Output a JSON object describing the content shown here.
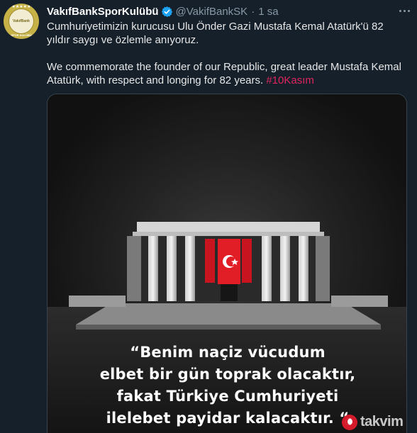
{
  "tweet": {
    "display_name": "VakıfBankSporKulübü",
    "handle": "@VakifBankSK",
    "separator": "·",
    "time": "1 sa",
    "text_tr": "Cumhuriyetimizin kurucusu Ulu Önder Gazi Mustafa Kemal Atatürk'ü 82 yıldır saygı ve özlemle anıyoruz.",
    "text_en": "We commemorate the founder of our Republic, great leader Mustafa Kemal Atatürk, with respect and longing for 82 years.",
    "hashtag": "#10Kasım"
  },
  "avatar": {
    "stars": "★★★★★",
    "brand": "VakıfBank",
    "bottom": "SPOR KULÜBÜ"
  },
  "image": {
    "quote_line1": "“Benim naçiz vücudum",
    "quote_line2": "elbet bir gün toprak olacaktır,",
    "quote_line3": "fakat Türkiye Cumhuriyeti",
    "quote_line4": "ilelebet payidar kalacaktır. “"
  },
  "watermark": {
    "text": "takvim"
  },
  "icons": {
    "verified": "verified-badge-icon",
    "more": "more-options-icon",
    "flag": "turkish-flag-icon"
  },
  "colors": {
    "background": "#15202b",
    "secondary_text": "#8899a6",
    "hashtag": "#e0245e",
    "verified": "#1da1f2",
    "flag_red": "#d41b2c"
  }
}
